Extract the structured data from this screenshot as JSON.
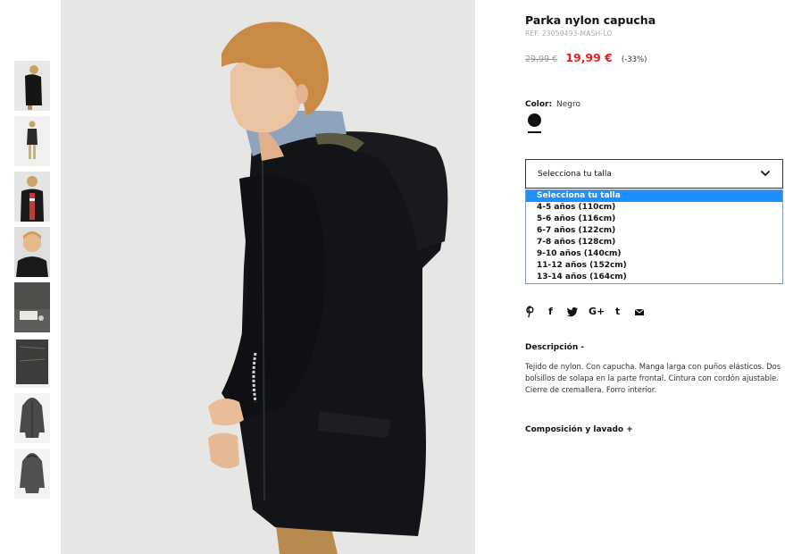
{
  "product": {
    "title": "Parka nylon capucha",
    "ref": "REF. 23050493-MASH-LO",
    "old_price": "29,99 €",
    "new_price": "19,99 €",
    "discount": "(-33%)",
    "color_label": "Color:",
    "color_value": "Negro"
  },
  "size_select": {
    "value": "Selecciona tu talla",
    "options": [
      "Selecciona tu talla",
      "4-5 años (110cm)",
      "5-6 años (116cm)",
      "6-7 años (122cm)",
      "7-8 años (128cm)",
      "9-10 años (140cm)",
      "11-12 años (152cm)",
      "13-14 años (164cm)"
    ],
    "selected_index": 0
  },
  "share": {
    "pinterest": "P",
    "facebook": "f",
    "twitter": "twitter-icon",
    "googleplus": "G+",
    "tumblr": "t",
    "email": "email-icon"
  },
  "description": {
    "heading": "Descripción  -",
    "text": "Tejido de nylon. Con capucha. Manga larga con puños elásticos. Dos bolsillos de solapa en la parte frontal. Cintura con cordón ajustable. Cierre de cremallera. Forro interior."
  },
  "composition": {
    "heading": "Composición y lavado  +"
  },
  "colors": {
    "price_red": "#e3202a",
    "highlight_blue": "#1e90ff",
    "garment_black": "#101010"
  }
}
